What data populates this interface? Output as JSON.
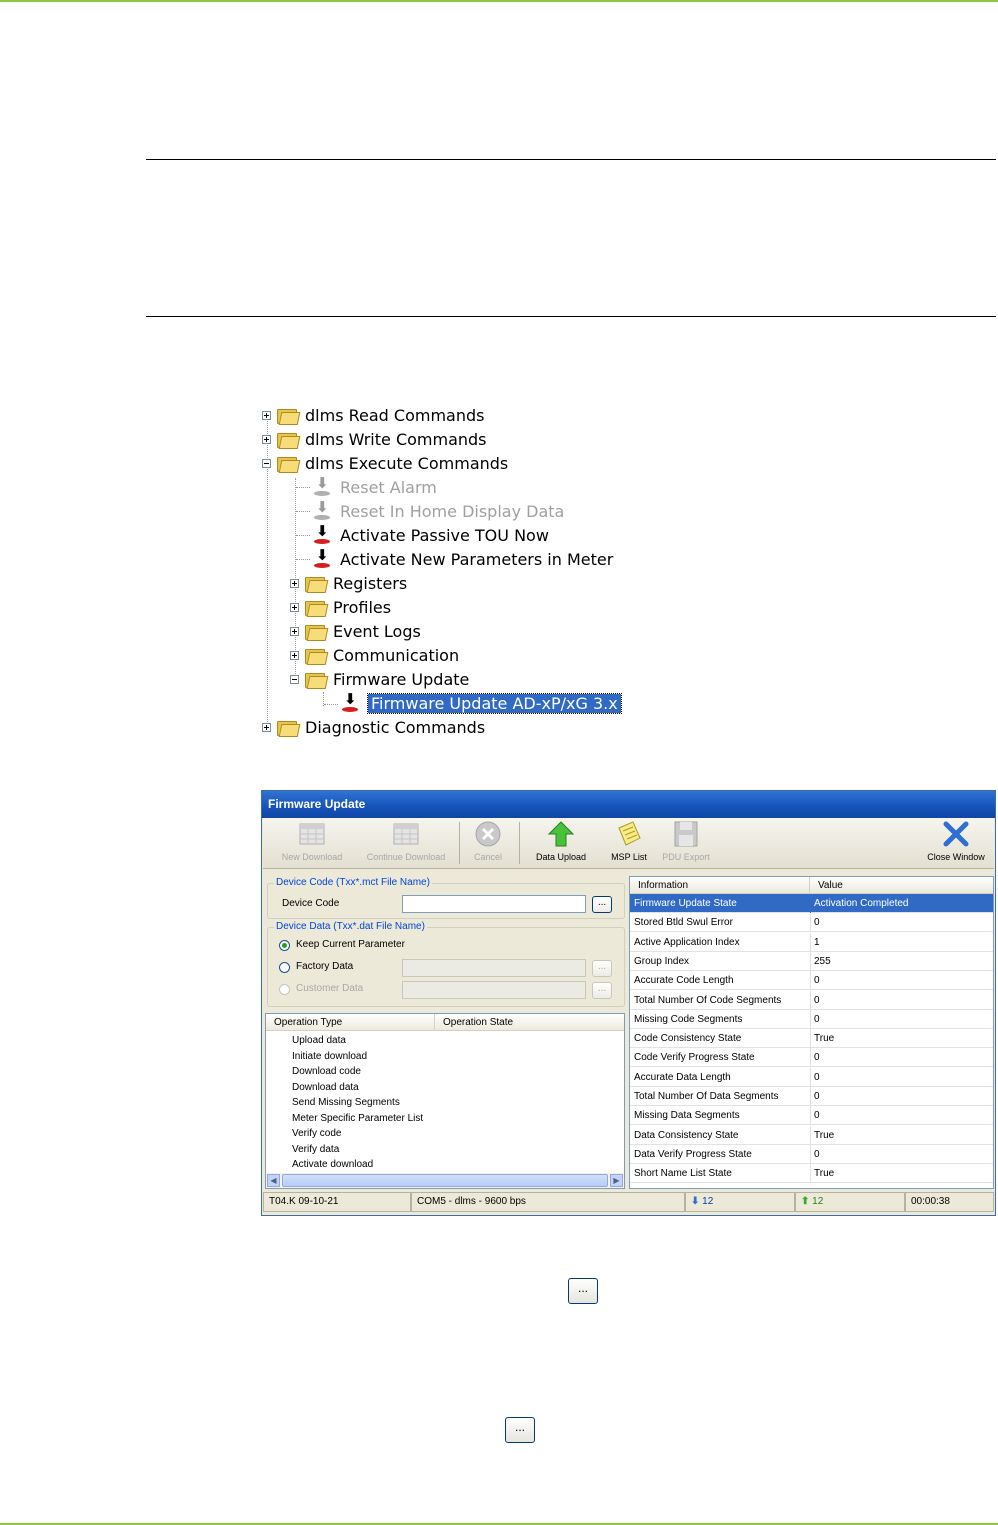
{
  "tree": {
    "items": [
      {
        "label": "dlms Read Commands"
      },
      {
        "label": "dlms Write Commands"
      },
      {
        "label": "dlms Execute Commands"
      },
      {
        "label": "Reset Alarm"
      },
      {
        "label": "Reset In Home Display Data"
      },
      {
        "label": "Activate Passive TOU Now"
      },
      {
        "label": "Activate New Parameters in Meter"
      },
      {
        "label": "Registers"
      },
      {
        "label": "Profiles"
      },
      {
        "label": "Event Logs"
      },
      {
        "label": "Communication"
      },
      {
        "label": "Firmware Update"
      },
      {
        "label": "Firmware Update AD-xP/xG 3.x"
      },
      {
        "label": "Diagnostic Commands"
      }
    ]
  },
  "window": {
    "title": "Firmware Update",
    "toolbar": {
      "new_download": "New Download",
      "continue_download": "Continue Download",
      "cancel": "Cancel",
      "data_upload": "Data Upload",
      "msp_list": "MSP List",
      "pdu_export": "PDU Export",
      "close_window": "Close Window"
    },
    "device_code_group": {
      "title": "Device Code (Txx*.mct File Name)",
      "label": "Device Code",
      "value": "",
      "browse": "..."
    },
    "device_data_group": {
      "title": "Device Data (Txx*.dat File Name)",
      "keep_current": "Keep Current Parameter",
      "factory_data": "Factory Data",
      "customer_data": "Customer Data",
      "browse": "..."
    },
    "operations": {
      "col_type": "Operation Type",
      "col_state": "Operation State",
      "rows": [
        "Upload data",
        "Initiate download",
        "Download code",
        "Download data",
        "Send Missing Segments",
        "Meter Specific Parameter List",
        "Verify code",
        "Verify data",
        "Activate download"
      ]
    },
    "info": {
      "col_info": "Information",
      "col_value": "Value",
      "rows": [
        {
          "name": "Firmware Update State",
          "value": "Activation Completed"
        },
        {
          "name": "Stored Btld Swul Error",
          "value": "0"
        },
        {
          "name": "Active Application Index",
          "value": "1"
        },
        {
          "name": "Group Index",
          "value": "255"
        },
        {
          "name": "Accurate Code Length",
          "value": "0"
        },
        {
          "name": "Total Number Of Code Segments",
          "value": "0"
        },
        {
          "name": "Missing Code Segments",
          "value": "0"
        },
        {
          "name": "Code Consistency State",
          "value": "True"
        },
        {
          "name": "Code Verify Progress State",
          "value": "0"
        },
        {
          "name": "Accurate Data Length",
          "value": "0"
        },
        {
          "name": "Total Number Of Data Segments",
          "value": "0"
        },
        {
          "name": "Missing Data Segments",
          "value": "0"
        },
        {
          "name": "Data Consistency State",
          "value": "True"
        },
        {
          "name": "Data Verify Progress State",
          "value": "0"
        },
        {
          "name": "Short Name List State",
          "value": "True"
        }
      ]
    },
    "statusbar": {
      "version": "T04.K 09-10-21",
      "connection": "COM5 - dlms - 9600 bps",
      "down_count": "12",
      "up_count": "12",
      "timer": "00:00:38"
    }
  },
  "page_buttons": {
    "browse_1": "...",
    "browse_2": "..."
  },
  "colors": {
    "accent_green": "#8dc63f",
    "selection": "#316ac5",
    "title_blue": "#1652b8"
  }
}
